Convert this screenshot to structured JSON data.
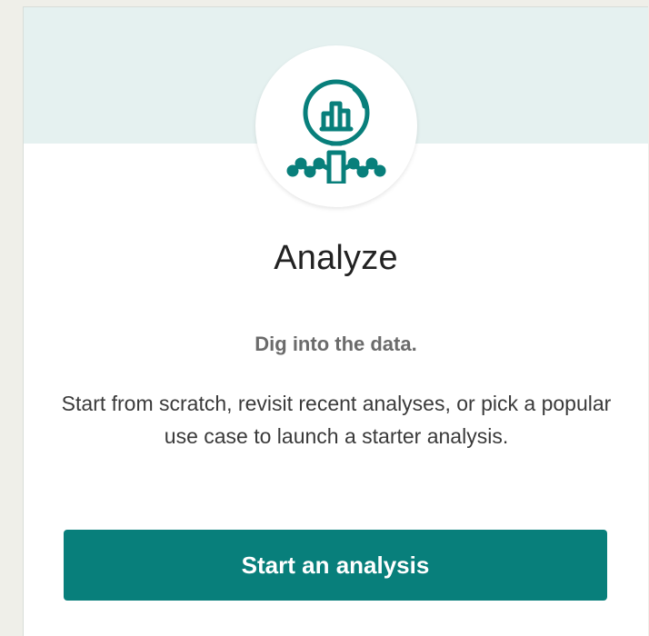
{
  "card": {
    "title": "Analyze",
    "tagline": "Dig into the data.",
    "description": "Start from scratch, revisit recent analyses, or pick a popular use case to launch a starter analysis.",
    "button_label": "Start an analysis",
    "icon": "magnifier-chart-icon"
  },
  "colors": {
    "accent": "#087f7b",
    "band": "#e5f1f0",
    "background": "#efefe9"
  }
}
